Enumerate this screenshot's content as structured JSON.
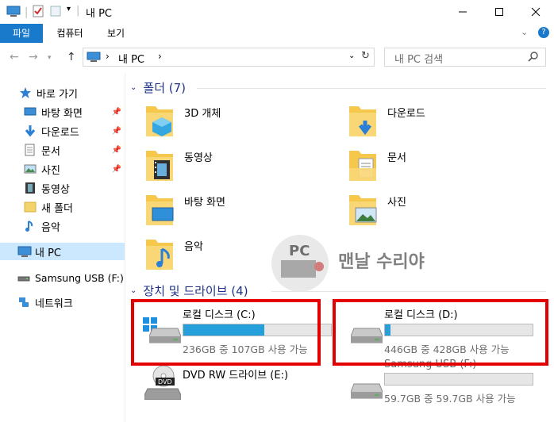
{
  "window": {
    "title": "내 PC"
  },
  "ribbon": {
    "tabs": [
      "파일",
      "컴퓨터",
      "보기"
    ]
  },
  "address": {
    "path": "내 PC"
  },
  "search": {
    "placeholder": "내 PC 검색"
  },
  "sidebar": {
    "quick_access": "바로 가기",
    "items": [
      {
        "label": "바탕 화면",
        "icon": "desktop-icon",
        "pinned": true
      },
      {
        "label": "다운로드",
        "icon": "download-icon",
        "pinned": true
      },
      {
        "label": "문서",
        "icon": "document-icon",
        "pinned": true
      },
      {
        "label": "사진",
        "icon": "picture-icon",
        "pinned": true
      },
      {
        "label": "동영상",
        "icon": "video-icon",
        "pinned": false
      },
      {
        "label": "새 폴더",
        "icon": "folder-icon",
        "pinned": false
      },
      {
        "label": "음악",
        "icon": "music-icon",
        "pinned": false
      }
    ],
    "this_pc": "내 PC",
    "usb": "Samsung USB (F:)",
    "network": "네트워크"
  },
  "folders_group": {
    "title": "폴더 (7)"
  },
  "folders": [
    {
      "label": "3D 개체",
      "icon": "3d-objects-icon"
    },
    {
      "label": "다운로드",
      "icon": "download-folder-icon"
    },
    {
      "label": "동영상",
      "icon": "video-folder-icon"
    },
    {
      "label": "문서",
      "icon": "document-folder-icon"
    },
    {
      "label": "바탕 화면",
      "icon": "desktop-folder-icon"
    },
    {
      "label": "사진",
      "icon": "picture-folder-icon"
    },
    {
      "label": "음악",
      "icon": "music-folder-icon"
    }
  ],
  "drives_group": {
    "title": "장치 및 드라이브 (4)"
  },
  "drives": [
    {
      "name": "로컬 디스크 (C:)",
      "info": "236GB 중 107GB 사용 가능",
      "used_fraction": 0.55,
      "bar_color": "#26a0da"
    },
    {
      "name": "로컬 디스크 (D:)",
      "info": "446GB 중 428GB 사용 가능",
      "used_fraction": 0.04,
      "bar_color": "#26a0da"
    },
    {
      "name": "DVD RW 드라이브 (E:)",
      "info": "",
      "used_fraction": null
    },
    {
      "name": "Samsung USB (F:)",
      "info": "59.7GB 중 59.7GB 사용 가능",
      "used_fraction": 0.0,
      "bar_color": "#26a0da"
    }
  ],
  "watermark": {
    "text": "맨날 수리야",
    "badge": "PC"
  },
  "colors": {
    "accent": "#1979ca",
    "selection": "#cce8ff",
    "highlight": "#e30000",
    "group_header": "#1e3287"
  }
}
